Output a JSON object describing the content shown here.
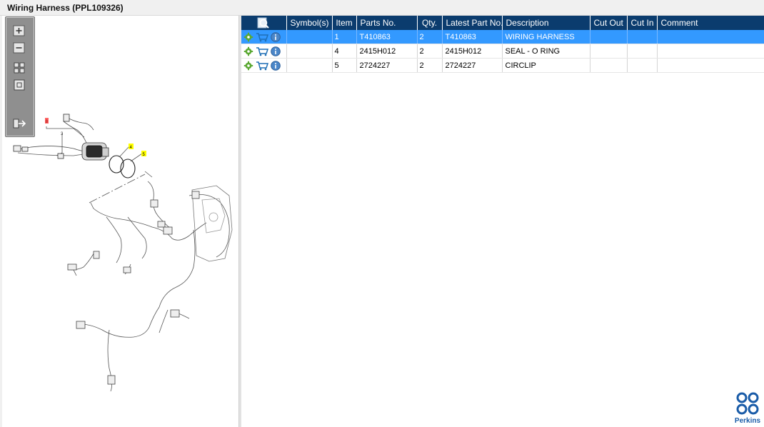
{
  "window": {
    "title": "Wiring Harness (PPL109326)"
  },
  "toolbox": {
    "zoom_in_icon": "plus-magnifier-icon",
    "zoom_out_icon": "minus-magnifier-icon",
    "fit_icon": "fit-all-icon",
    "actual_size_icon": "actual-size-icon",
    "export_icon": "export-arrow-icon"
  },
  "drawing": {
    "callouts": [
      "8",
      "3",
      "4",
      "5"
    ]
  },
  "table": {
    "columns": [
      "",
      "Symbol(s)",
      "Item",
      "Parts No.",
      "Qty.",
      "Latest Part No.",
      "Description",
      "Cut Out",
      "Cut In",
      "Comment"
    ],
    "rows": [
      {
        "item": "1",
        "parts_no": "T410863",
        "qty": "2",
        "latest": "T410863",
        "description": "WIRING HARNESS",
        "symbols": "",
        "cut_out": "",
        "cut_in": "",
        "comment": "",
        "selected": true
      },
      {
        "item": "4",
        "parts_no": "2415H012",
        "qty": "2",
        "latest": "2415H012",
        "description": "SEAL - O RING",
        "symbols": "",
        "cut_out": "",
        "cut_in": "",
        "comment": "",
        "selected": false
      },
      {
        "item": "5",
        "parts_no": "2724227",
        "qty": "2",
        "latest": "2724227",
        "description": "CIRCLIP",
        "symbols": "",
        "cut_out": "",
        "cut_in": "",
        "comment": "",
        "selected": false
      }
    ]
  },
  "brand": {
    "name": "Perkins",
    "color": "#1a5ca8"
  },
  "colors": {
    "header_bg": "#0b3c6e",
    "selected_row": "#3399ff",
    "callout_yellow": "#ffff00",
    "callout_red": "#ff6666"
  }
}
